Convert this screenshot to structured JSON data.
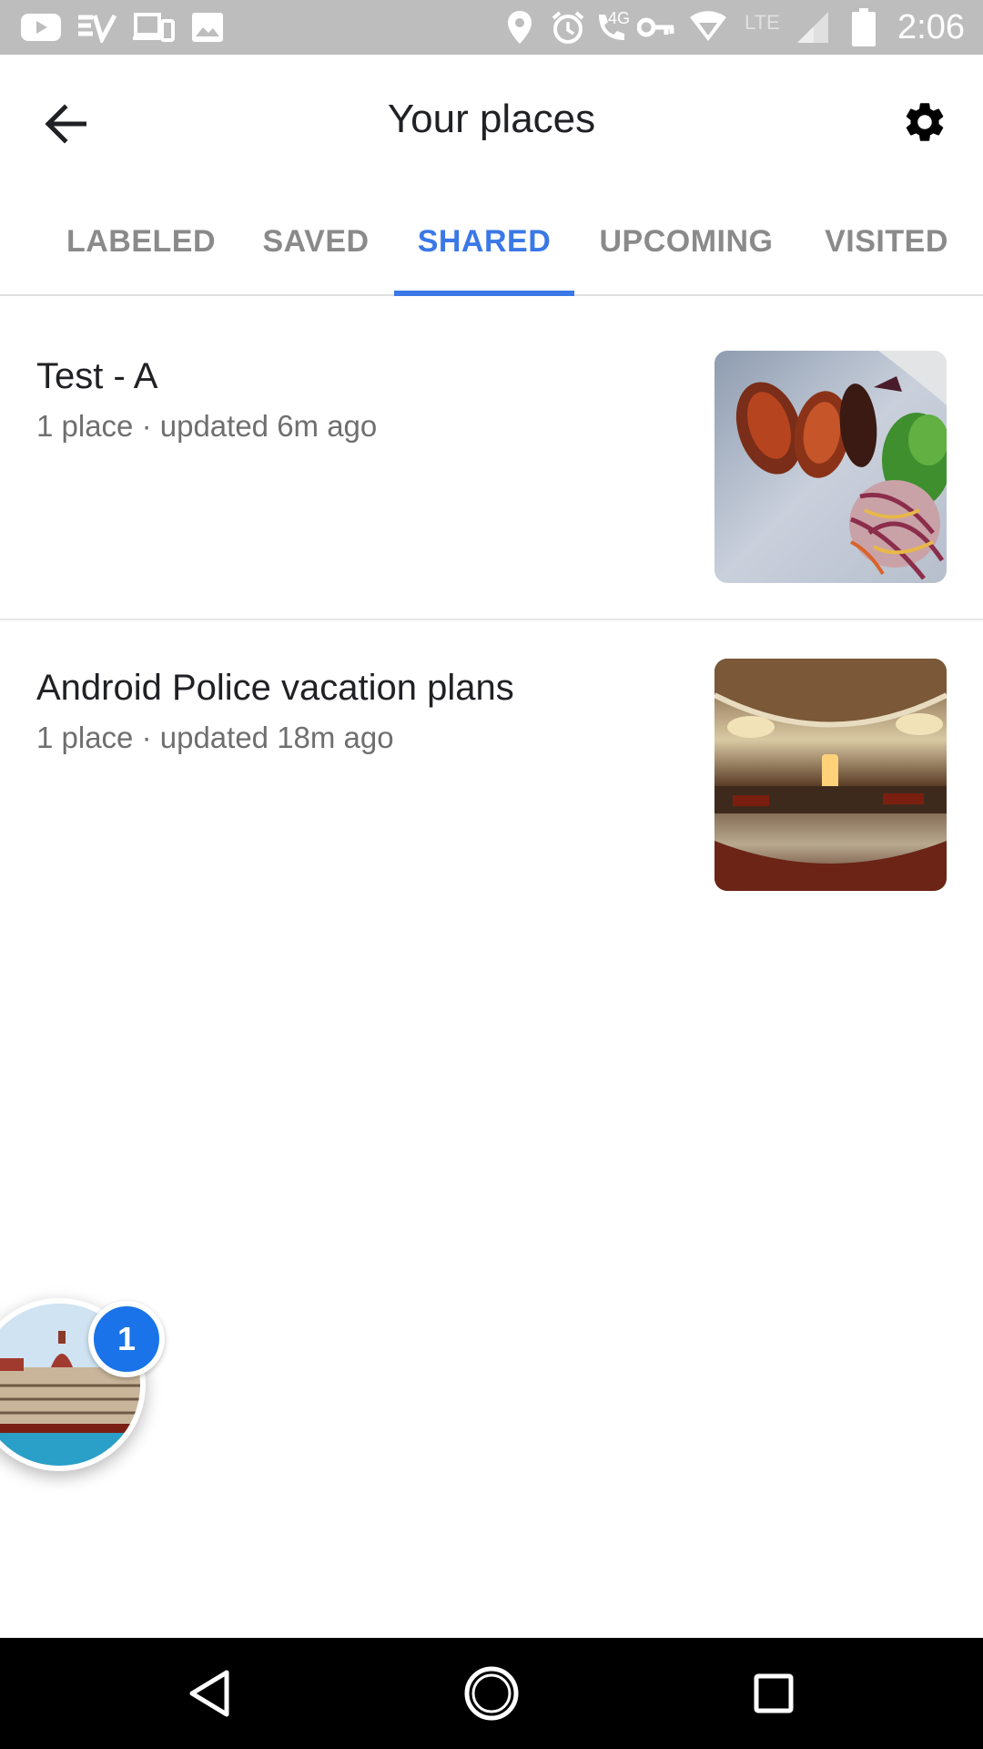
{
  "status_bar": {
    "time": "2:06",
    "network_label": "LTE",
    "call_label": "4G",
    "icons": [
      "youtube-icon",
      "ev-icon",
      "devices-icon",
      "image-icon",
      "location-icon",
      "alarm-icon",
      "wifi-calling-icon",
      "vpn-key-icon",
      "wifi-icon",
      "signal-icon",
      "battery-icon"
    ]
  },
  "app_bar": {
    "title": "Your places",
    "back_icon": "arrow-back-icon",
    "settings_icon": "gear-icon"
  },
  "tabs": [
    {
      "label": "LABELED",
      "active": false
    },
    {
      "label": "SAVED",
      "active": false
    },
    {
      "label": "SHARED",
      "active": true
    },
    {
      "label": "UPCOMING",
      "active": false
    },
    {
      "label": "VISITED",
      "active": false
    }
  ],
  "lists": [
    {
      "title": "Test - A",
      "subtitle": "1 place · updated 6m ago",
      "thumbnail": "food-plate-photo"
    },
    {
      "title": "Android Police vacation plans",
      "subtitle": "1 place · updated 18m ago",
      "thumbnail": "hotel-lobby-photo"
    }
  ],
  "bubble": {
    "badge_count": "1",
    "image": "palace-hotel-photo"
  },
  "nav_bar": {
    "buttons": [
      "back-nav-icon",
      "home-nav-icon",
      "recents-nav-icon"
    ]
  },
  "colors": {
    "accent": "#3b78e7",
    "badge": "#1a73e8",
    "status_bar": "#bdbdbd",
    "nav_bar": "#000000"
  }
}
